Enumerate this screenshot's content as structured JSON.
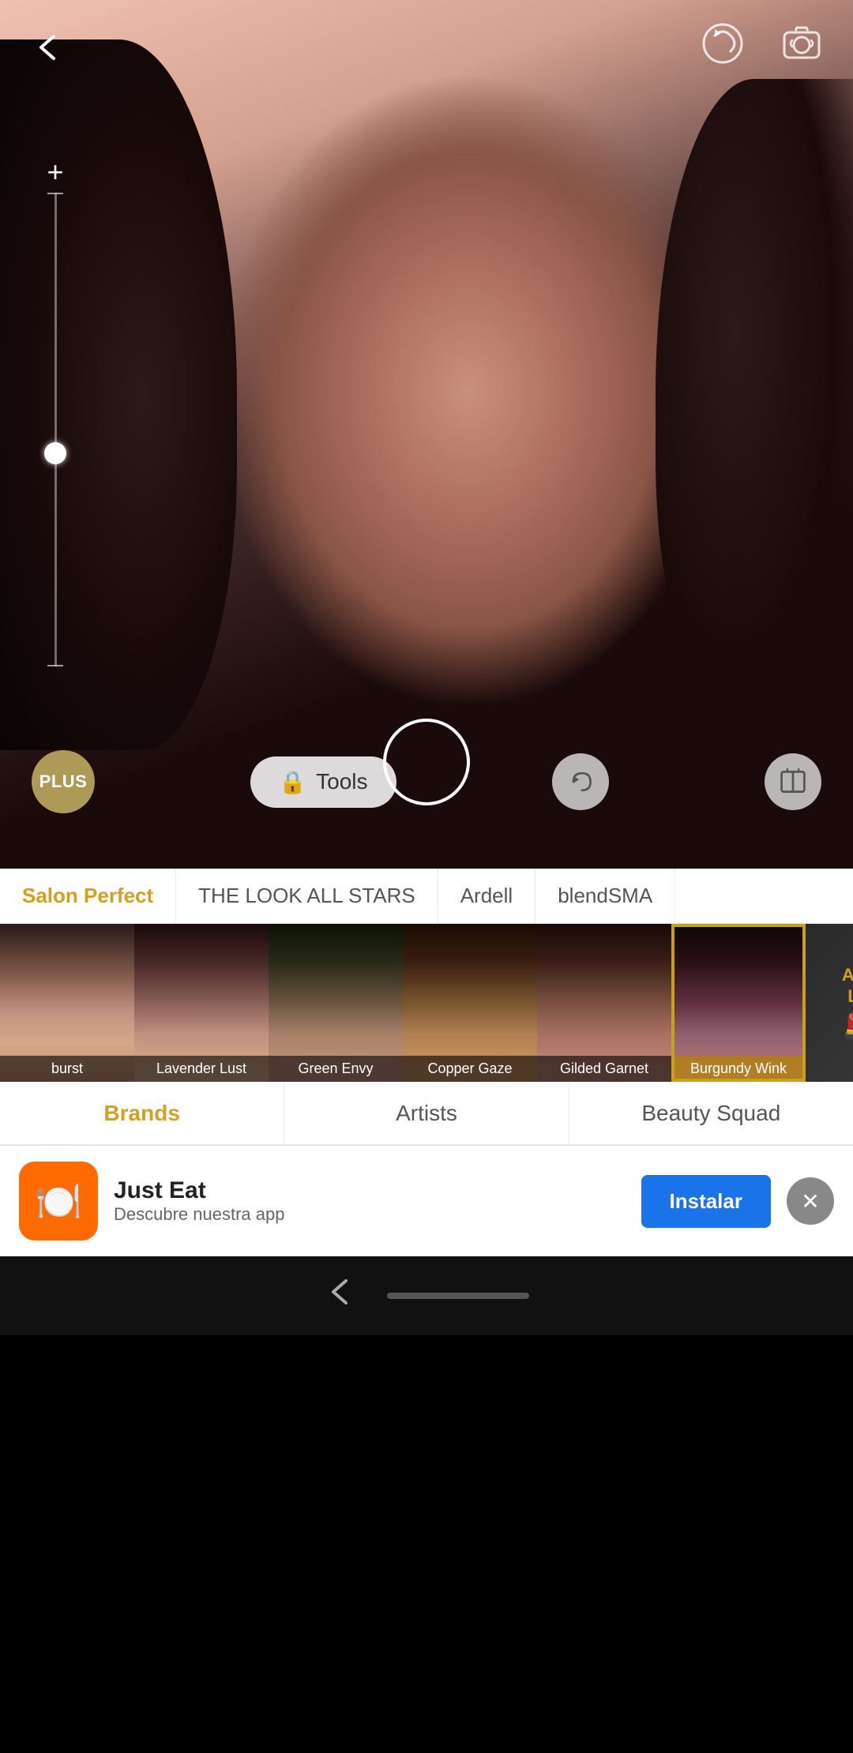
{
  "header": {
    "back_label": "‹",
    "reset_label": "↺",
    "camera_switch_label": "⊙"
  },
  "camera": {
    "capture_visible": true
  },
  "toolbar": {
    "plus_label": "PLUS",
    "tools_label": "Tools",
    "undo_label": "↺",
    "compare_label": "⊡"
  },
  "brand_tabs": [
    {
      "id": "salon-perfect",
      "label": "Salon Perfect",
      "active": true
    },
    {
      "id": "the-look-all-stars",
      "label": "THE LOOK ALL STARS",
      "active": false
    },
    {
      "id": "ardell",
      "label": "Ardell",
      "active": false
    },
    {
      "id": "blendsma",
      "label": "blendSMA",
      "active": false
    }
  ],
  "looks": [
    {
      "id": "look-0",
      "label": "burst",
      "selected": false,
      "face_class": "face-1"
    },
    {
      "id": "look-1",
      "label": "Lavender Lust",
      "selected": false,
      "face_class": "face-2"
    },
    {
      "id": "look-2",
      "label": "Green Envy",
      "selected": false,
      "face_class": "face-3"
    },
    {
      "id": "look-3",
      "label": "Copper Gaze",
      "selected": false,
      "face_class": "face-4"
    },
    {
      "id": "look-4",
      "label": "Gilded Garnet",
      "selected": false,
      "face_class": "face-5"
    },
    {
      "id": "look-5",
      "label": "Burgundy Wink",
      "selected": true,
      "face_class": "face-6"
    },
    {
      "id": "look-6",
      "label": "ABOUT LOOK",
      "selected": false,
      "is_about": true
    }
  ],
  "filter_tabs": [
    {
      "id": "brands",
      "label": "Brands",
      "active": true
    },
    {
      "id": "artists",
      "label": "Artists",
      "active": false
    },
    {
      "id": "beauty-squad",
      "label": "Beauty Squad",
      "active": false
    }
  ],
  "ad": {
    "icon": "🍽",
    "title": "Just Eat",
    "subtitle": "Descubre nuestra app",
    "install_label": "Instalar",
    "close_label": "✕"
  },
  "nav": {
    "back_label": "‹",
    "indicator": ""
  }
}
